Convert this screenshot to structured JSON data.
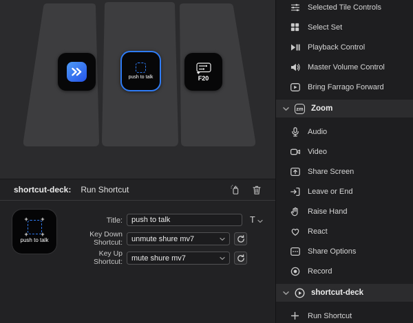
{
  "colors": {
    "accent": "#2f7cf6"
  },
  "deck": {
    "tiles": [
      {
        "name": "run-shortcut",
        "icon": "shortcuts-icon",
        "label": ""
      },
      {
        "name": "push-to-talk",
        "icon": "dashed-frame-icon",
        "label": "push to talk",
        "selected": true
      },
      {
        "name": "f20",
        "icon": "key-controls-icon",
        "label": "F20"
      }
    ]
  },
  "inspector": {
    "app_name": "shortcut-deck:",
    "action_name": "Run Shortcut",
    "preview_label": "push to talk",
    "title_label": "Title:",
    "title_value": "push to talk",
    "font_control": "T",
    "key_down_label": "Key Down Shortcut:",
    "key_down_value": "unmute shure mv7",
    "key_up_label": "Key Up Shortcut:",
    "key_up_value": "mute shure mv7"
  },
  "sidebar": {
    "items": [
      {
        "type": "action",
        "label": "Selected Tile Controls",
        "icon": "tile-controls-icon"
      },
      {
        "type": "action",
        "label": "Select Set",
        "icon": "select-set-icon"
      },
      {
        "type": "action",
        "label": "Playback Control",
        "icon": "playback-icon"
      },
      {
        "type": "action",
        "label": "Master Volume Control",
        "icon": "volume-icon"
      },
      {
        "type": "action",
        "label": "Bring Farrago Forward",
        "icon": "farrago-icon"
      },
      {
        "type": "section",
        "label": "Zoom",
        "icon": "zoom-logo-icon"
      },
      {
        "type": "action",
        "label": "Audio",
        "icon": "microphone-icon"
      },
      {
        "type": "action",
        "label": "Video",
        "icon": "video-camera-icon"
      },
      {
        "type": "action",
        "label": "Share Screen",
        "icon": "share-screen-icon"
      },
      {
        "type": "action",
        "label": "Leave or End",
        "icon": "leave-icon"
      },
      {
        "type": "action",
        "label": "Raise Hand",
        "icon": "raise-hand-icon"
      },
      {
        "type": "action",
        "label": "React",
        "icon": "react-icon"
      },
      {
        "type": "action",
        "label": "Share Options",
        "icon": "share-options-icon"
      },
      {
        "type": "action",
        "label": "Record",
        "icon": "record-icon"
      },
      {
        "type": "section",
        "label": "shortcut-deck",
        "icon": "shortcut-deck-icon"
      },
      {
        "type": "action",
        "label": "Run Shortcut",
        "icon": "plus-icon"
      }
    ]
  }
}
